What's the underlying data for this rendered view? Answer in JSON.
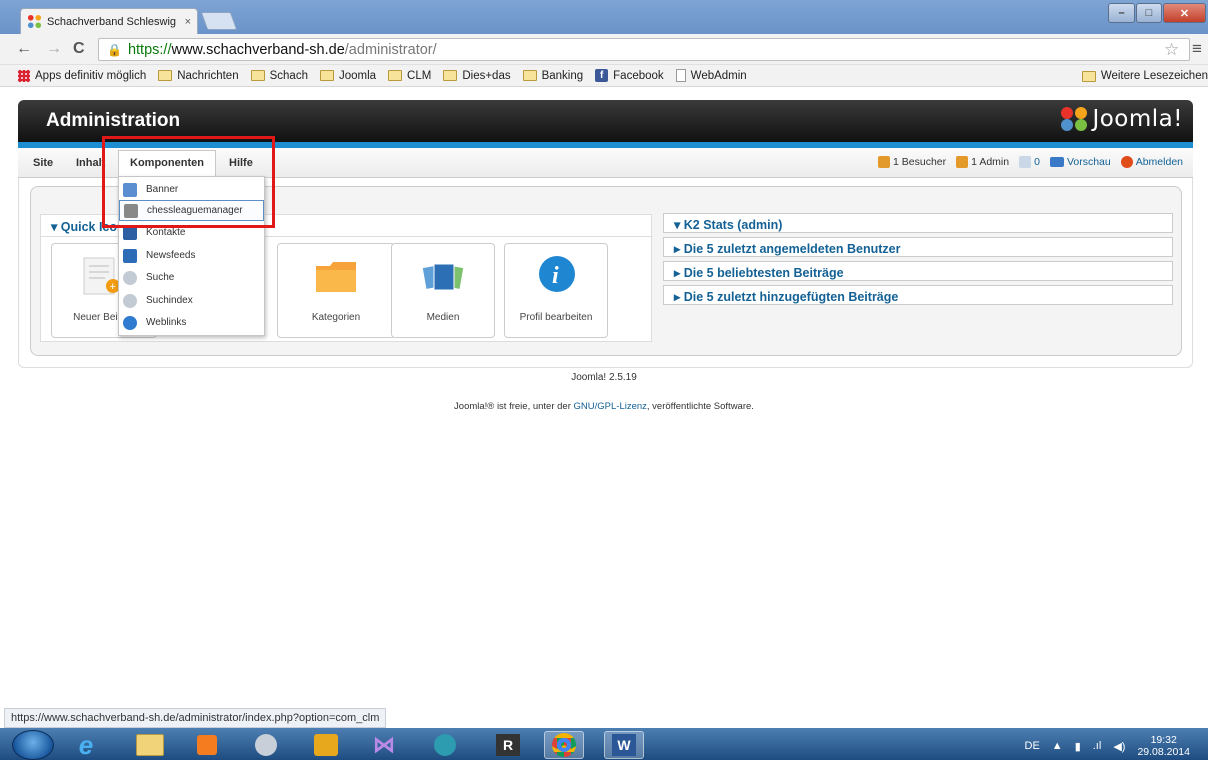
{
  "browser": {
    "tab_title": "Schachverband Schleswig",
    "tab_close": "×",
    "url_scheme": "https://",
    "url_host": "www.schachverband-sh.de",
    "url_path": "/administrator/",
    "bookmarks": [
      "Apps definitiv möglich",
      "Nachrichten",
      "Schach",
      "Joomla",
      "CLM",
      "Dies+das",
      "Banking",
      "Facebook",
      "WebAdmin"
    ],
    "bookmarks_other": "Weitere Lesezeichen",
    "status_url": "https://www.schachverband-sh.de/administrator/index.php?option=com_clm"
  },
  "admin": {
    "title": "Administration",
    "logo_text": "Joomla!",
    "menu": [
      "Site",
      "Inhalt",
      "Komponenten",
      "Hilfe"
    ],
    "status": {
      "visitors": "1 Besucher",
      "admins": "1 Admin",
      "messages": "0",
      "preview": "Vorschau",
      "logout": "Abmelden"
    },
    "dropdown": [
      {
        "label": "Banner",
        "icon": "banner-icon",
        "color": "#5b8ed0"
      },
      {
        "label": "chessleaguemanager",
        "icon": "chess-icon",
        "color": "#666666"
      },
      {
        "label": "Kontakte",
        "icon": "contacts-icon",
        "color": "#2c5fa3"
      },
      {
        "label": "Newsfeeds",
        "icon": "newsfeed-icon",
        "color": "#2d6db8"
      },
      {
        "label": "Suche",
        "icon": "search-icon",
        "color": "#9aa6b2"
      },
      {
        "label": "Suchindex",
        "icon": "search-index-icon",
        "color": "#9aa6b2"
      },
      {
        "label": "Weblinks",
        "icon": "weblinks-icon",
        "color": "#2f7bd0"
      }
    ],
    "quick_icons_title": "Quick Icons",
    "quick_icons": [
      "Neuer Beitrag",
      "Kategorien",
      "Medien",
      "Profil bearbeiten"
    ],
    "accordions": [
      "K2 Stats (admin)",
      "Die 5 zuletzt angemeldeten Benutzer",
      "Die 5 beliebtesten Beiträge",
      "Die 5 zuletzt hinzugefügten Beiträge"
    ],
    "footer_version": "Joomla! 2.5.19",
    "footer_license_pre": "Joomla!® ist freie, unter der ",
    "footer_license_link": "GNU/GPL-Lizenz",
    "footer_license_post": ", veröffentlichte Software."
  },
  "taskbar": {
    "language": "DE",
    "time": "19:32",
    "date": "29.08.2014"
  }
}
